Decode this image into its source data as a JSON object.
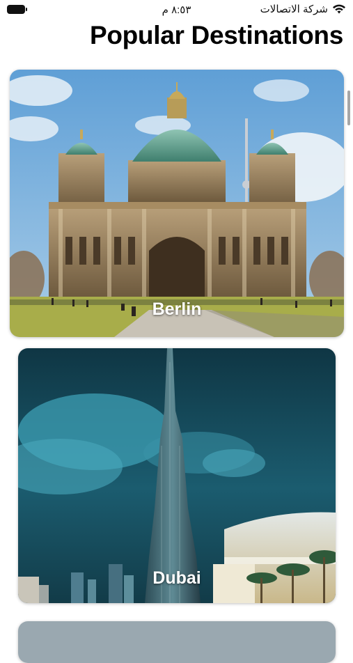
{
  "status": {
    "time": "٨:٥٣ م",
    "carrier": "شركة الاتصالات",
    "battery_icon": "battery-icon",
    "wifi_icon": "wifi-icon"
  },
  "header": {
    "title": "Popular Destinations"
  },
  "destinations": [
    {
      "name": "Berlin",
      "image": "berlin-cathedral-photo"
    },
    {
      "name": "Dubai",
      "image": "dubai-burj-khalifa-photo"
    },
    {
      "name": "",
      "image": "partial-next-card-photo"
    }
  ]
}
